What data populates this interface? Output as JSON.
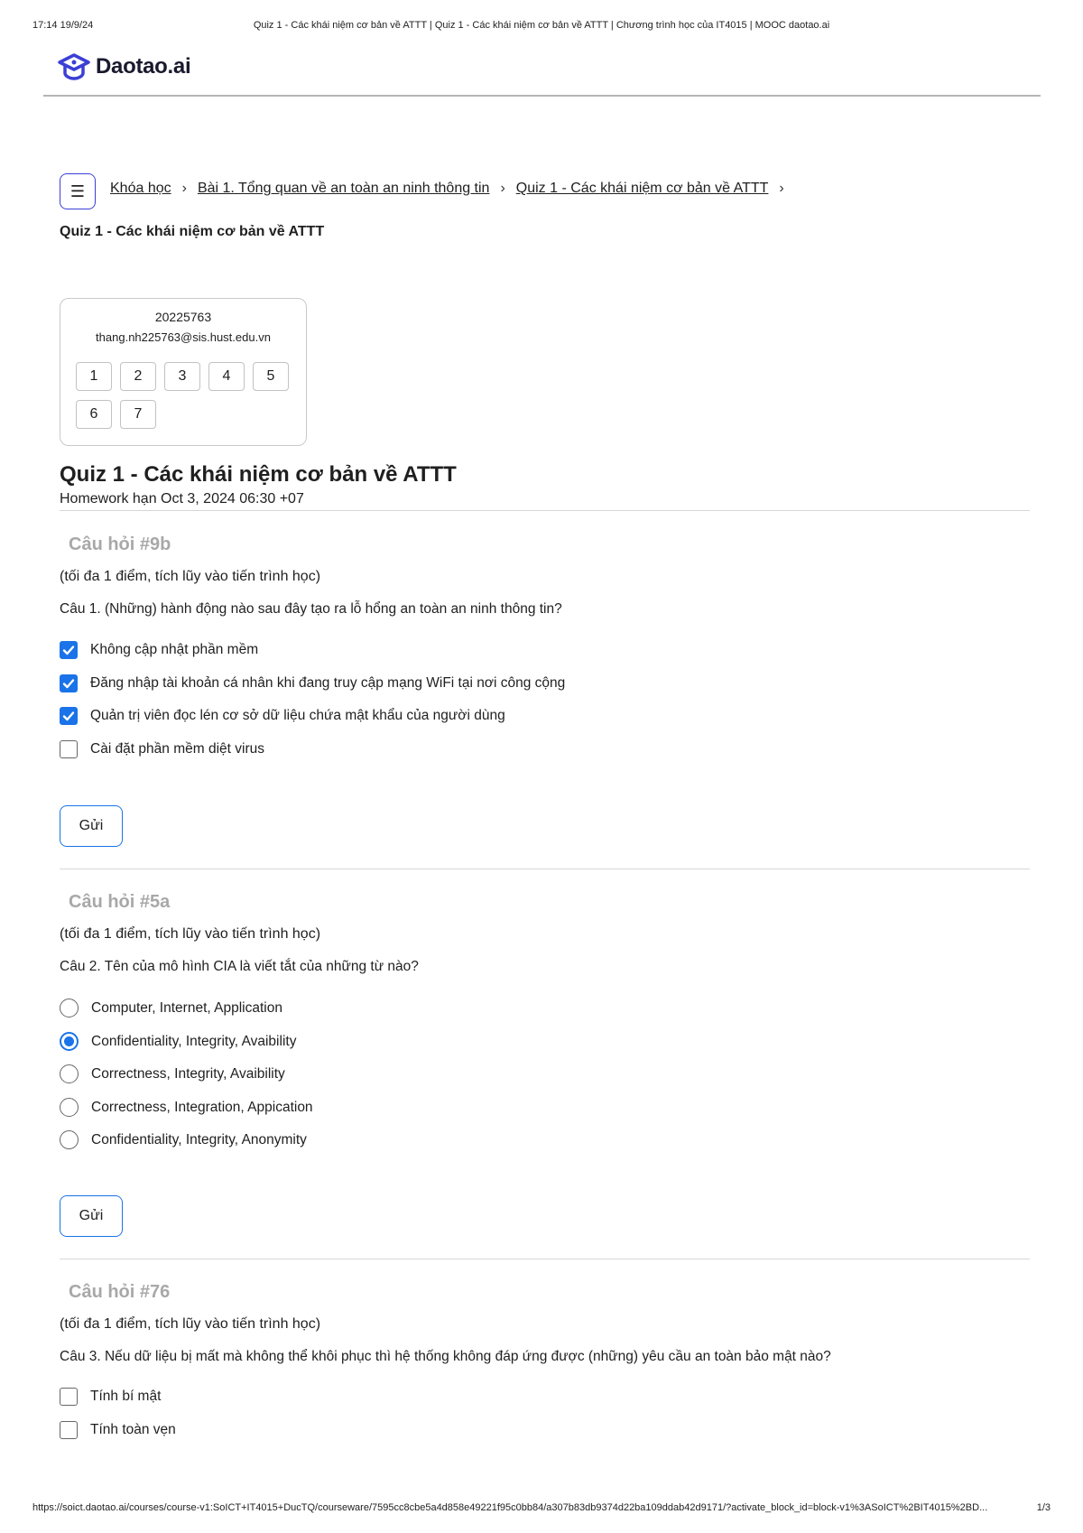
{
  "print_header": {
    "datetime": "17:14 19/9/24",
    "title": "Quiz 1 - Các khái niệm cơ bản về ATTT | Quiz 1 - Các khái niệm cơ bản về ATTT | Chương trình học của IT4015 | MOOC daotao.ai"
  },
  "print_footer": {
    "url": "https://soict.daotao.ai/courses/course-v1:SoICT+IT4015+DucTQ/courseware/7595cc8cbe5a4d858e49221f95c0bb84/a307b83db9374d22ba109ddab42d9171/?activate_block_id=block-v1%3ASoICT%2BIT4015%2BD...",
    "page": "1/3"
  },
  "logo": {
    "name": "Daotao.ai",
    "color": "#3b3fd6"
  },
  "breadcrumb": {
    "items": [
      "Khóa học",
      "Bài 1. Tổng quan về an toàn an ninh thông tin",
      "Quiz 1 - Các khái niệm cơ bản về ATTT"
    ],
    "separator": ">",
    "current": "Quiz 1 - Các khái niệm cơ bản về ATTT"
  },
  "user": {
    "id": "20225763",
    "email": "thang.nh225763@sis.hust.edu.vn",
    "question_nav": [
      "1",
      "2",
      "3",
      "4",
      "5",
      "6",
      "7"
    ]
  },
  "quiz": {
    "title": "Quiz 1 - Các khái niệm cơ bản về ATTT",
    "deadline": "Homework hạn Oct 3, 2024 06:30 +07"
  },
  "questions": [
    {
      "heading": "Câu hỏi #9b",
      "points": "(tối đa 1 điểm, tích lũy vào tiến trình học)",
      "text": "Câu 1. (Những) hành động nào sau đây tạo ra lỗ hổng an toàn an ninh thông tin?",
      "type": "checkbox",
      "options": [
        {
          "label": "Không cập nhật phần mềm",
          "checked": true
        },
        {
          "label": "Đăng nhập tài khoản cá nhân khi đang truy cập mạng WiFi tại nơi công cộng",
          "checked": true
        },
        {
          "label": "Quản trị viên đọc lén cơ sở dữ liệu chứa mật khẩu của người dùng",
          "checked": true
        },
        {
          "label": "Cài đặt phần mềm diệt virus",
          "checked": false
        }
      ],
      "submit_label": "Gửi"
    },
    {
      "heading": "Câu hỏi #5a",
      "points": "(tối đa 1 điểm, tích lũy vào tiến trình học)",
      "text": "Câu 2. Tên của mô hình CIA là viết tắt của những từ nào?",
      "type": "radio",
      "options": [
        {
          "label": "Computer, Internet, Application",
          "checked": false
        },
        {
          "label": "Confidentiality, Integrity, Avaibility",
          "checked": true
        },
        {
          "label": "Correctness, Integrity, Avaibility",
          "checked": false
        },
        {
          "label": "Correctness, Integration, Appication",
          "checked": false
        },
        {
          "label": "Confidentiality, Integrity, Anonymity",
          "checked": false
        }
      ],
      "submit_label": "Gửi"
    },
    {
      "heading": "Câu hỏi #76",
      "points": "(tối đa 1 điểm, tích lũy vào tiến trình học)",
      "text": "Câu 3. Nếu dữ liệu bị mất mà không thể khôi phục thì hệ thống không đáp ứng được (những) yêu cầu an toàn bảo mật nào?",
      "type": "checkbox",
      "options": [
        {
          "label": "Tính bí mật",
          "checked": false
        },
        {
          "label": "Tính toàn vẹn",
          "checked": false
        }
      ]
    }
  ]
}
